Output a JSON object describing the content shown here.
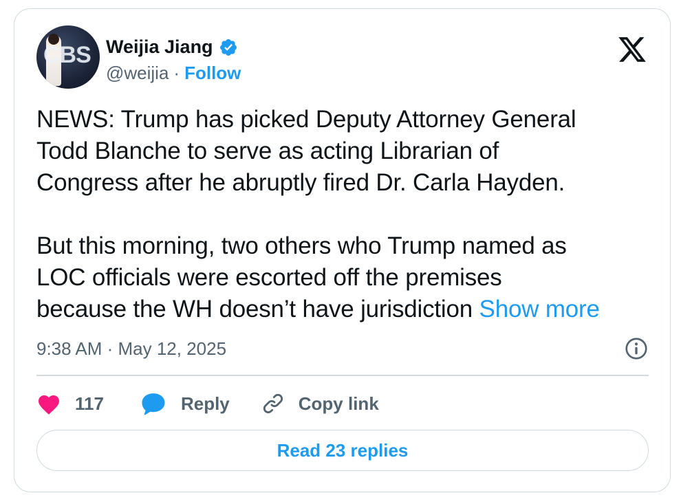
{
  "author": {
    "name": "Weijia Jiang",
    "handle": "@weijia",
    "separator": "·",
    "follow_label": "Follow",
    "avatar_text": "CBS",
    "verified": true
  },
  "tweet": {
    "paragraph_1": "NEWS: Trump has picked Deputy Attorney General\nTodd Blanche to serve as acting Librarian of\nCongress after he abruptly fired Dr. Carla Hayden.",
    "paragraph_2": "But this morning, two others who Trump named as\nLOC officials were escorted off the premises\nbecause the WH doesn’t have jurisdiction ",
    "show_more_label": "Show more"
  },
  "meta": {
    "timestamp": "9:38 AM · May 12, 2025"
  },
  "actions": {
    "like_count": "117",
    "reply_label": "Reply",
    "copy_link_label": "Copy link"
  },
  "read_replies_label": "Read 23 replies",
  "icons": {
    "brand": "x-logo-icon",
    "verified": "verified-badge-icon",
    "info": "info-icon",
    "like": "heart-icon",
    "reply": "speech-bubble-icon",
    "copy": "link-icon"
  },
  "colors": {
    "accent": "#1d9bf0",
    "like": "#f91880",
    "text": "#0f1419",
    "secondary_text": "#536471",
    "border": "#cfd9de"
  }
}
